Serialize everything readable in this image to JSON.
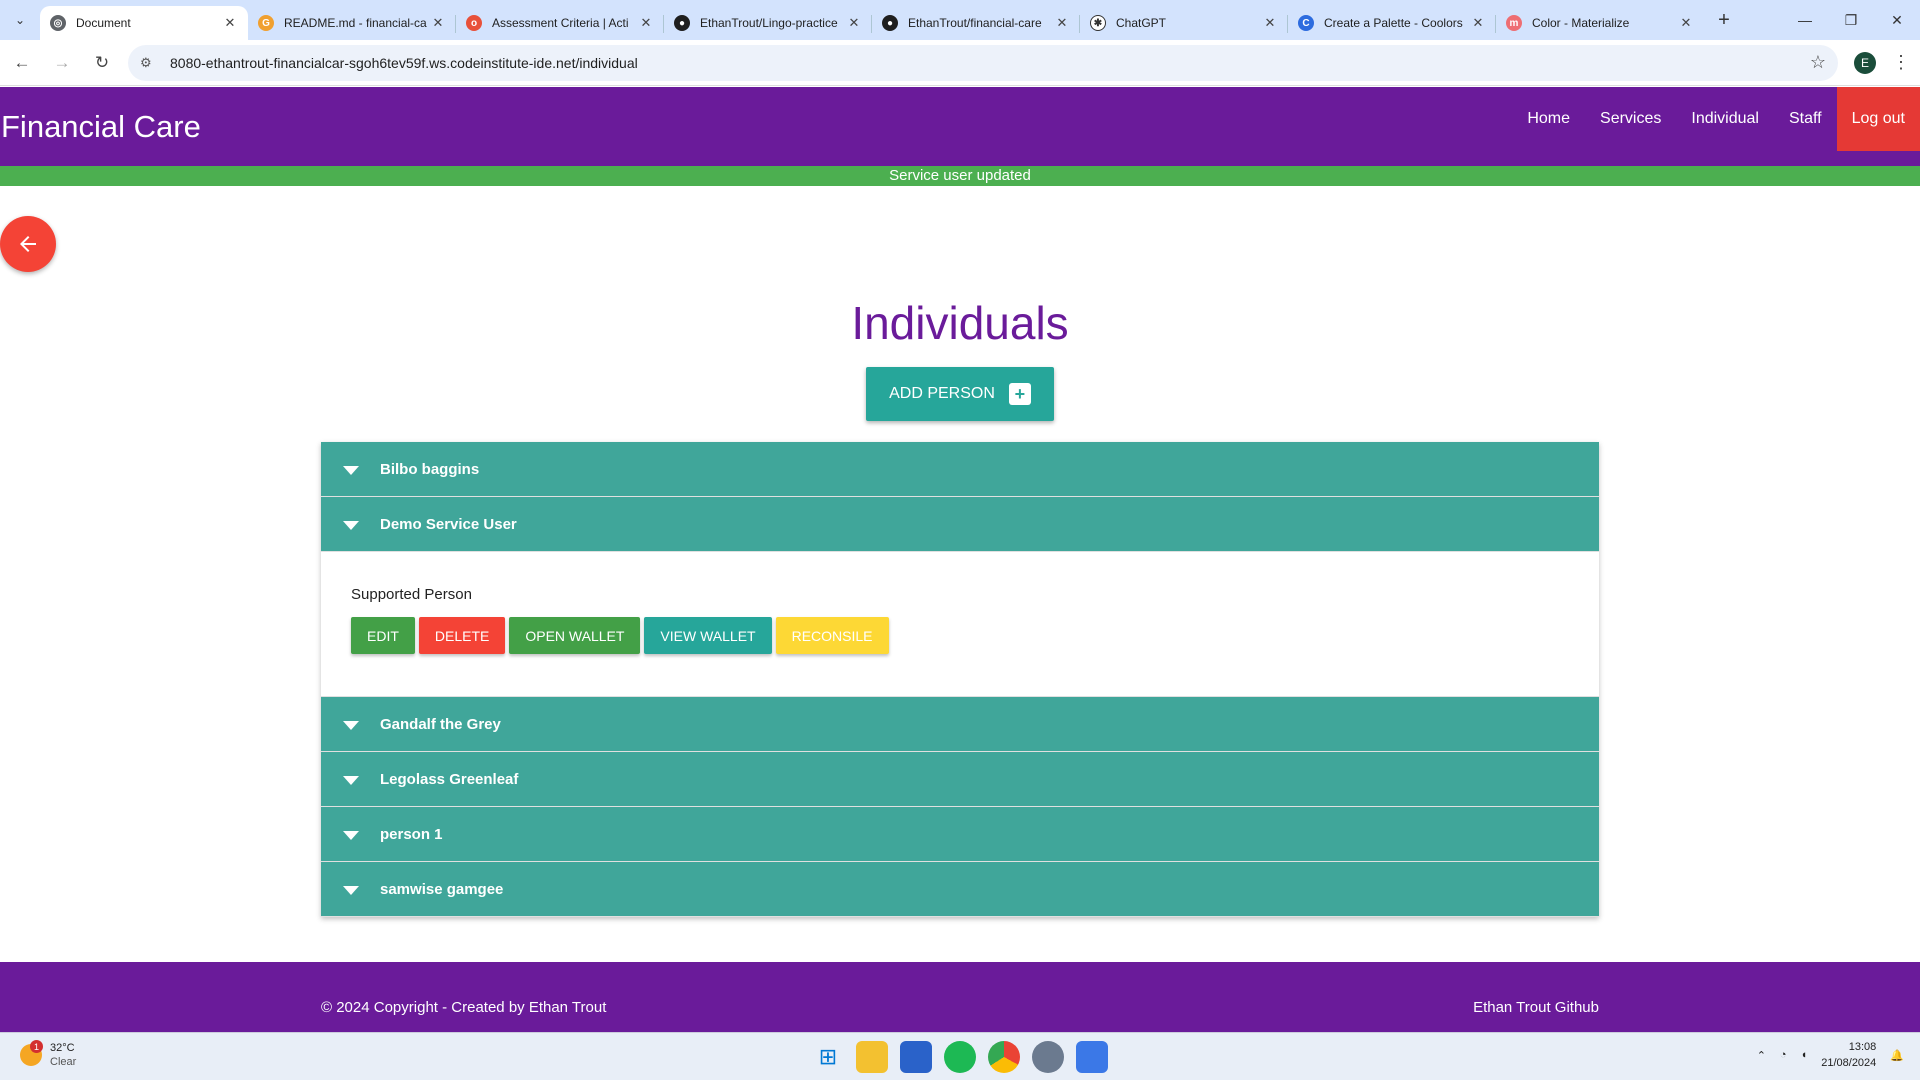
{
  "browser": {
    "tabs": [
      {
        "title": "Document",
        "active": true
      },
      {
        "title": "README.md - financial-ca",
        "active": false
      },
      {
        "title": "Assessment Criteria | Acti",
        "active": false
      },
      {
        "title": "EthanTrout/Lingo-practice",
        "active": false
      },
      {
        "title": "EthanTrout/financial-care",
        "active": false
      },
      {
        "title": "ChatGPT",
        "active": false
      },
      {
        "title": "Create a Palette - Coolors",
        "active": false
      },
      {
        "title": "Color - Materialize",
        "active": false
      }
    ],
    "url": "8080-ethantrout-financialcar-sgoh6tev59f.ws.codeinstitute-ide.net/individual",
    "profile_initial": "E"
  },
  "site": {
    "brand": "Financial Care",
    "nav": {
      "home": "Home",
      "services": "Services",
      "individual": "Individual",
      "staff": "Staff",
      "logout": "Log out"
    },
    "flash_message": "Service user updated",
    "page_title": "Individuals",
    "add_button": "ADD PERSON",
    "individuals": [
      {
        "name": "Bilbo baggins",
        "expanded": false
      },
      {
        "name": "Demo Service User",
        "expanded": true,
        "role": "Supported Person"
      },
      {
        "name": "Gandalf the Grey",
        "expanded": false
      },
      {
        "name": "Legolass Greenleaf",
        "expanded": false
      },
      {
        "name": "person 1",
        "expanded": false
      },
      {
        "name": "samwise gamgee",
        "expanded": false
      }
    ],
    "actions": {
      "edit": "EDIT",
      "delete": "DELETE",
      "open_wallet": "OPEN WALLET",
      "view_wallet": "VIEW WALLET",
      "reconsile": "RECONSILE"
    },
    "footer": {
      "copyright": "© 2024 Copyright - Created by Ethan Trout",
      "github": "Ethan Trout Github"
    },
    "colors": {
      "primary": "#6a1b9a",
      "teal": "#26a69a",
      "success": "#4caf50",
      "danger": "#f44336",
      "warning": "#fdd835"
    }
  },
  "taskbar": {
    "weather_temp": "32°C",
    "weather_desc": "Clear",
    "weather_badge": "1",
    "time": "13:08",
    "date": "21/08/2024"
  }
}
